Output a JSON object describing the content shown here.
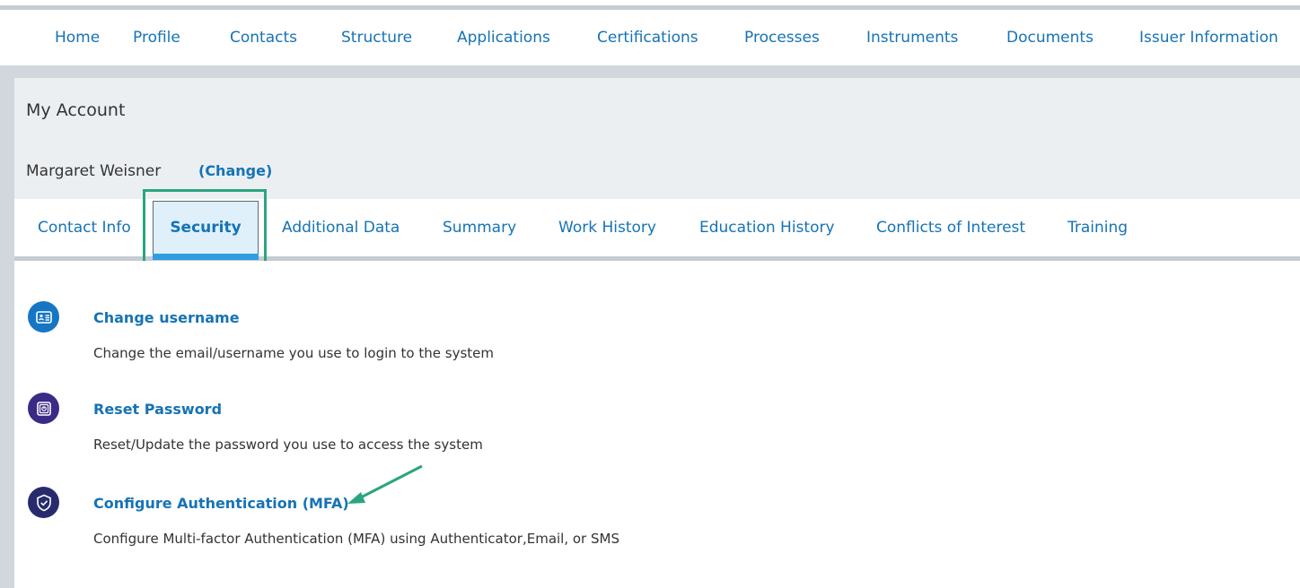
{
  "nav": {
    "items": [
      "Home",
      "Profile",
      "Contacts",
      "Structure",
      "Applications",
      "Certifications",
      "Processes",
      "Instruments",
      "Documents",
      "Issuer Information"
    ]
  },
  "account": {
    "title": "My Account",
    "user_name": "Margaret Weisner",
    "change_label": "(Change)"
  },
  "tabs": {
    "items": [
      "Contact Info",
      "Security",
      "Additional Data",
      "Summary",
      "Work History",
      "Education History",
      "Conflicts of Interest",
      "Training"
    ],
    "active": "Security"
  },
  "security": {
    "items": [
      {
        "title": "Change username",
        "description": "Change the email/username you use to login to the system",
        "icon": "id-card-icon",
        "color": "#1676c4"
      },
      {
        "title": "Reset Password",
        "description": "Reset/Update the password you use to access the system",
        "icon": "safe-icon",
        "color": "#3b2a86"
      },
      {
        "title": "Configure Authentication (MFA)",
        "description": "Configure Multi-factor Authentication (MFA) using Authenticator,Email, or SMS",
        "icon": "shield-check-icon",
        "color": "#272b6e"
      }
    ]
  },
  "colors": {
    "link": "#1673b5",
    "highlight": "#2aa57f",
    "tab_active_bg": "#dff0fb",
    "tab_active_bar": "#2f9ee0"
  }
}
